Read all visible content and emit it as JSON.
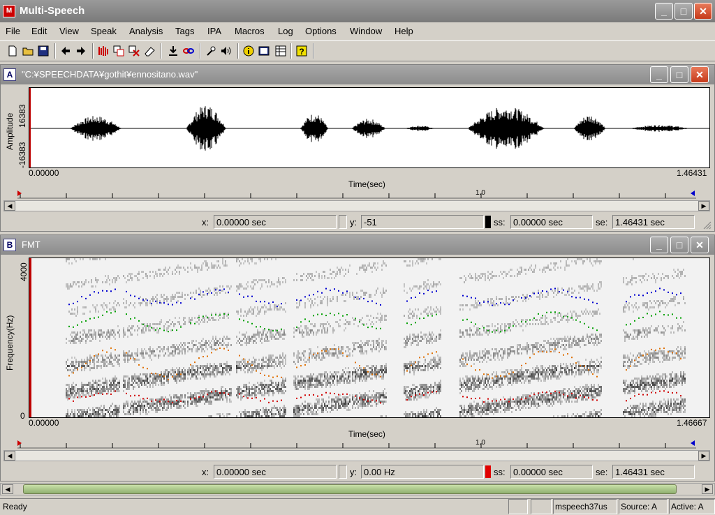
{
  "app": {
    "title": "Multi-Speech",
    "icon_text": "M"
  },
  "menu": [
    "File",
    "Edit",
    "View",
    "Speak",
    "Analysis",
    "Tags",
    "IPA",
    "Macros",
    "Log",
    "Options",
    "Window",
    "Help"
  ],
  "window_a": {
    "letter": "A",
    "title": "\"C:¥SPEECHDATA¥gothit¥ennositano.wav\"",
    "ylabel": "Amplitude",
    "ymax": "16383",
    "ymin": "-16383",
    "xstart": "0.00000",
    "xend": "1.46431",
    "xlabel": "Time(sec)",
    "ruler_mark": "1.0",
    "status": {
      "x_label": "x:",
      "x_value": "0.00000 sec",
      "y_label": "y:",
      "y_value": "-51",
      "ss_label": "ss:",
      "ss_value": "0.00000 sec",
      "se_label": "se:",
      "se_value": "1.46431 sec",
      "marker_color": "#000000"
    }
  },
  "window_b": {
    "letter": "B",
    "title": "FMT",
    "ylabel": "Frequency(Hz)",
    "ymax": "4000",
    "ymin": "0",
    "xstart": "0.00000",
    "xend": "1.46667",
    "xlabel": "Time(sec)",
    "ruler_mark": "1.0",
    "status": {
      "x_label": "x:",
      "x_value": "0.00000 sec",
      "y_label": "y:",
      "y_value": "0.00 Hz",
      "ss_label": "ss:",
      "ss_value": "0.00000 sec",
      "se_label": "se:",
      "se_value": "1.46431 sec",
      "marker_color": "#e00000"
    }
  },
  "window_buttons": {
    "minimize": "_",
    "maximize": "□",
    "close": "✕"
  },
  "statusbar": {
    "ready": "Ready",
    "panel1": "",
    "panel2": "",
    "panel3": "mspeech37us",
    "source": "Source: A",
    "active": "Active: A"
  },
  "colors": {
    "cursor": "#c00000",
    "f1": "#d00000",
    "f2": "#e07000",
    "f3": "#00a000",
    "f4": "#0000d0"
  }
}
